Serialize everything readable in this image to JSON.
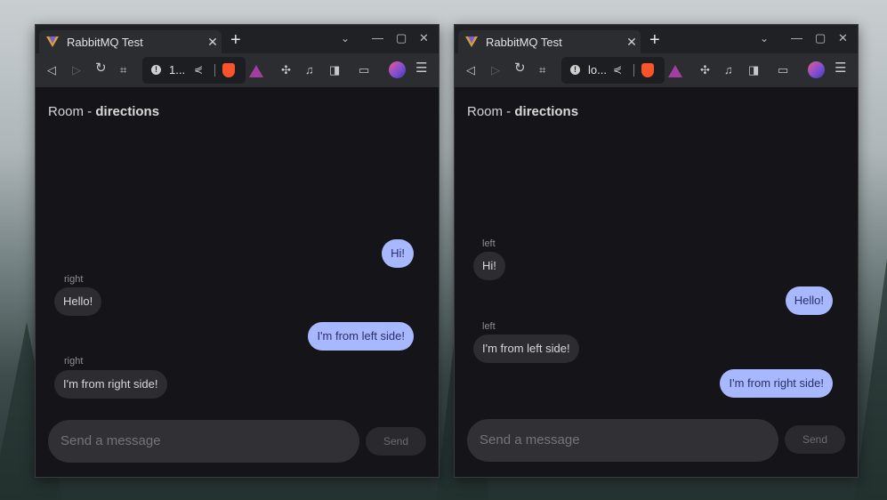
{
  "windows": [
    {
      "tab_title": "RabbitMQ Test",
      "url": "1...",
      "room_label": "Room -",
      "room_name": "directions",
      "input_placeholder": "Send a message",
      "send_label": "Send",
      "messages": [
        {
          "side": "mine",
          "sender": "",
          "text": "Hi!"
        },
        {
          "side": "other",
          "sender": "right",
          "text": "Hello!"
        },
        {
          "side": "mine",
          "sender": "",
          "text": "I'm from left side!"
        },
        {
          "side": "other",
          "sender": "right",
          "text": "I'm from right side!"
        }
      ]
    },
    {
      "tab_title": "RabbitMQ Test",
      "url": "lo...",
      "room_label": "Room -",
      "room_name": "directions",
      "input_placeholder": "Send a message",
      "send_label": "Send",
      "messages": [
        {
          "side": "other",
          "sender": "left",
          "text": "Hi!"
        },
        {
          "side": "mine",
          "sender": "",
          "text": "Hello!"
        },
        {
          "side": "other",
          "sender": "left",
          "text": "I'm from left side!"
        },
        {
          "side": "mine",
          "sender": "",
          "text": "I'm from right side!"
        }
      ]
    }
  ],
  "colors": {
    "own_bubble": "#a8b8ff",
    "other_bubble": "#2c2c31",
    "app_background": "#151519"
  },
  "icons": [
    "vivaldi-logo-icon",
    "close-icon",
    "plus-icon",
    "chevron-down-icon",
    "minimize-icon",
    "maximize-icon",
    "back-icon",
    "forward-icon",
    "reload-icon",
    "bookmark-icon",
    "info-icon",
    "share-icon",
    "brave-shield-icon",
    "bat-rewards-icon",
    "extensions-icon",
    "music-icon",
    "sidebar-icon",
    "wallet-icon",
    "profile-avatar",
    "menu-icon"
  ]
}
